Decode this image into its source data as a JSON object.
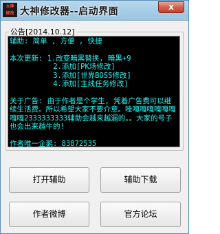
{
  "window": {
    "logo_line1": "大神",
    "logo_line2": "修改",
    "title": "大神修改器--启动界面",
    "close_label": "x"
  },
  "announcement": {
    "legend": "公告[2014.10.12]",
    "lines": [
      "辅助: 简单 , 方便 , 快捷",
      "",
      "本次更新: 1.改变暗黑替换, 暗黑+9",
      "          2.添加[PK场修改]",
      "          3.添加[世界BOSS修改]",
      "          4.添加[主线任务修改]",
      ""
    ],
    "ad_text": "关于广告: 由于作者是个学生, 凭着广告费可以继续生活费。所以希望大家不要介意。哇嘎嘎嘎嘎嘎嘎嘎嘎2333333333辅助会越来越漏的。。大家的号子也会出来越牛的!",
    "contact": "作者唯一企鹅: 83872535"
  },
  "buttons": {
    "open_helper": "打开辅助",
    "download_helper": "辅助下载",
    "author_weibo": "作者微博",
    "official_forum": "官方论坛"
  }
}
